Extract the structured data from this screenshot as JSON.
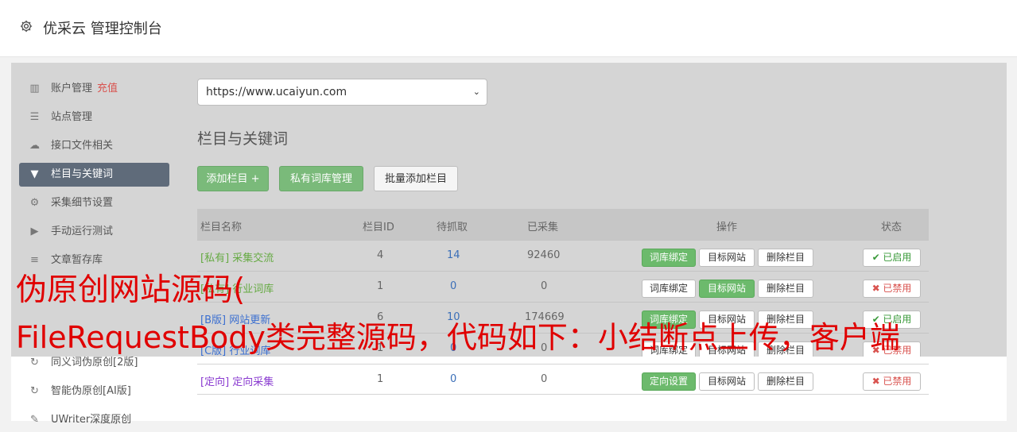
{
  "header": {
    "title": "优采云 管理控制台"
  },
  "sidebar": {
    "items": [
      {
        "label": "账户管理",
        "extra": "充值",
        "icon": "bar-chart-icon"
      },
      {
        "label": "站点管理",
        "icon": "server-icon"
      },
      {
        "label": "接口文件相关",
        "icon": "cloud-upload-icon"
      },
      {
        "label": "栏目与关键词",
        "icon": "filter-icon"
      },
      {
        "label": "采集细节设置",
        "icon": "gears-icon"
      },
      {
        "label": "手动运行测试",
        "icon": "play-circle-icon"
      },
      {
        "label": "文章暂存库",
        "icon": "database-icon"
      },
      {
        "label": "同义词伪原创[2版]",
        "icon": "refresh-icon"
      },
      {
        "label": "智能伪原创[AI版]",
        "icon": "refresh-icon"
      },
      {
        "label": "UWriter深度原创",
        "icon": "edit-icon"
      }
    ]
  },
  "site_select": {
    "value": "https://www.ucaiyun.com"
  },
  "main": {
    "heading": "栏目与关键词",
    "buttons": {
      "add_column": "添加栏目 +",
      "private_lexicon": "私有词库管理",
      "batch_add": "批量添加栏目"
    }
  },
  "table": {
    "headers": [
      "栏目名称",
      "栏目ID",
      "待抓取",
      "已采集",
      "操作",
      "状态"
    ],
    "rows": [
      {
        "tag": "[私有]",
        "name": "采集交流",
        "id": "4",
        "pending": "14",
        "collected": "92460",
        "op1": "词库绑定",
        "op2": "目标网站",
        "op3": "删除栏目",
        "status": "✔ 已启用"
      },
      {
        "tag": "[私有]",
        "name": "行业词库",
        "id": "1",
        "pending": "0",
        "collected": "0",
        "op1": "词库绑定",
        "op2": "目标网站",
        "op3": "删除栏目",
        "status": "✖ 已禁用"
      },
      {
        "tag": "[B版]",
        "name": "网站更新",
        "id": "6",
        "pending": "10",
        "collected": "174669",
        "op1": "词库绑定",
        "op2": "目标网站",
        "op3": "删除栏目",
        "status": "✔ 已启用"
      },
      {
        "tag": "[C版]",
        "name": "行业词库",
        "id": "1",
        "pending": "0",
        "collected": "0",
        "op1": "词库绑定",
        "op2": "目标网站",
        "op3": "删除栏目",
        "status": "✖ 已禁用"
      },
      {
        "tag": "[定向]",
        "name": "定向采集",
        "id": "1",
        "pending": "0",
        "collected": "0",
        "op1": "定向设置",
        "op2": "目标网站",
        "op3": "删除栏目",
        "status": "✖ 已禁用"
      }
    ]
  },
  "overlay": {
    "line1": "伪原创网站源码(",
    "line2": "FileRequestBody类完整源码，代码如下：小结断点上传，客户端"
  },
  "colors": {
    "accent_green": "#7aba7a",
    "active_sidebar": "#5f6b7a",
    "disabled_red": "#d9534f",
    "overlay_red": "#e00000"
  }
}
